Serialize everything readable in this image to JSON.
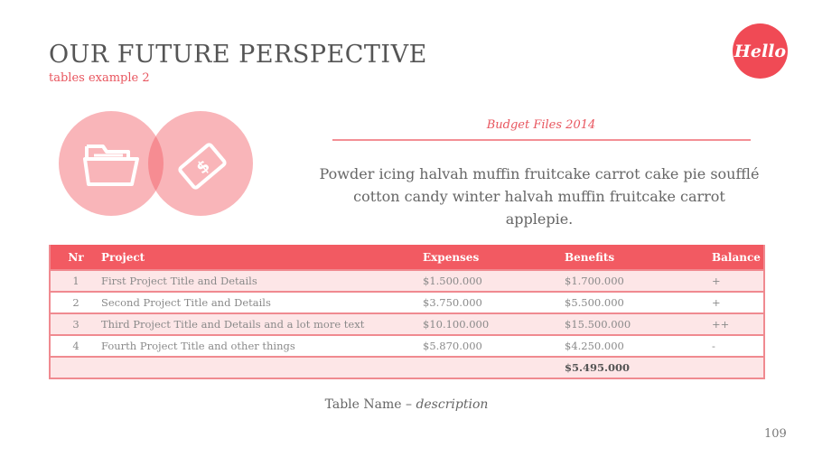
{
  "header": {
    "title": "OUR FUTURE PERSPECTIVE",
    "subtitle": "tables example 2",
    "badge": "Hello"
  },
  "icons": [
    "folder-icon",
    "money-bill-icon"
  ],
  "section": {
    "heading": "Budget Files 2014",
    "paragraph": "Powder icing halvah muffin fruitcake carrot cake pie soufflé cotton candy winter halvah muffin fruitcake carrot applepie."
  },
  "table": {
    "columns": [
      "Nr",
      "Project",
      "Expenses",
      "Benefits",
      "Balance"
    ],
    "rows": [
      [
        "1",
        "First Project Title and Details",
        "$1.500.000",
        "$1.700.000",
        "+"
      ],
      [
        "2",
        "Second Project Title and Details",
        "$3.750.000",
        "$5.500.000",
        "+"
      ],
      [
        "3",
        "Third Project Title and Details and a lot more text",
        "$10.100.000",
        "$15.500.000",
        "++"
      ],
      [
        "4",
        "Fourth Project Title and other things",
        "$5.870.000",
        "$4.250.000",
        "-"
      ]
    ],
    "total": "$5.495.000"
  },
  "caption": {
    "name": "Table Name – ",
    "description": "description"
  },
  "page_number": "109",
  "colors": {
    "accent": "#f25a62",
    "circle": "#f7a5aa",
    "row_alt": "#fde6e7"
  }
}
